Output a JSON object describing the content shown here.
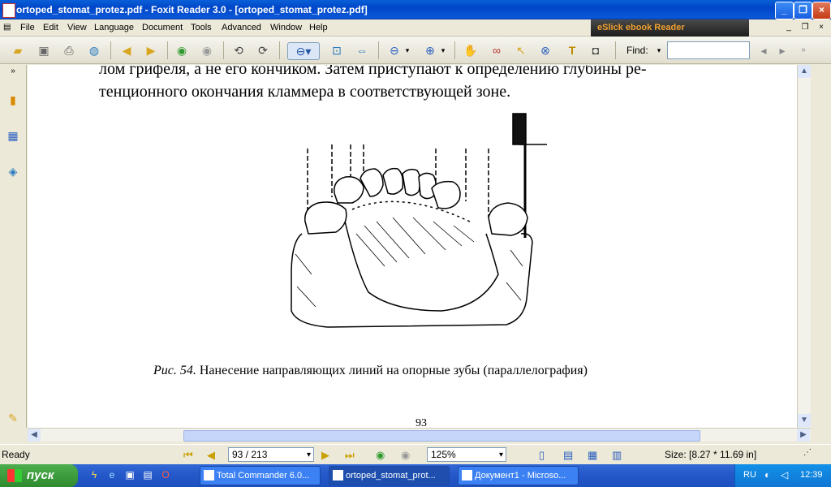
{
  "window": {
    "title": "ortoped_stomat_protez.pdf - Foxit Reader 3.0 - [ortoped_stomat_protez.pdf]",
    "min": "_",
    "max": "❐",
    "close": "×"
  },
  "menu": {
    "items": [
      "File",
      "Edit",
      "View",
      "Language",
      "Document",
      "Tools",
      "Advanced",
      "Window",
      "Help"
    ],
    "eslick": "eSlick ebook Reader",
    "mdi_min": "_",
    "mdi_restore": "❐",
    "mdi_close": "×"
  },
  "toolbar": {
    "find_label": "Find:",
    "find_value": ""
  },
  "document": {
    "line1": "лом грифеля, а не его кончиком. Затем приступают к определению глубины ре-",
    "line2": "тенционного окончания кламмера в соответствующей зоне.",
    "caption_fig": "Рис. 54.",
    "caption_text": " Нанесение направляющих линий на опорные зубы (параллелография)",
    "page_number": "93"
  },
  "status": {
    "ready": "Ready",
    "page_field": "93 / 213",
    "zoom": "125%",
    "size": "Size: [8.27 * 11.69 in]"
  },
  "taskbar": {
    "start": "пуск",
    "tasks": [
      "Total Commander 6.0...",
      "ortoped_stomat_prot...",
      "Документ1 - Microso..."
    ],
    "lang": "RU",
    "clock": "12:39"
  },
  "colors": {
    "titlebar": "#0a5fd8",
    "taskbar": "#2457c8",
    "start": "#3c9a3c",
    "page": "#ffffff"
  }
}
